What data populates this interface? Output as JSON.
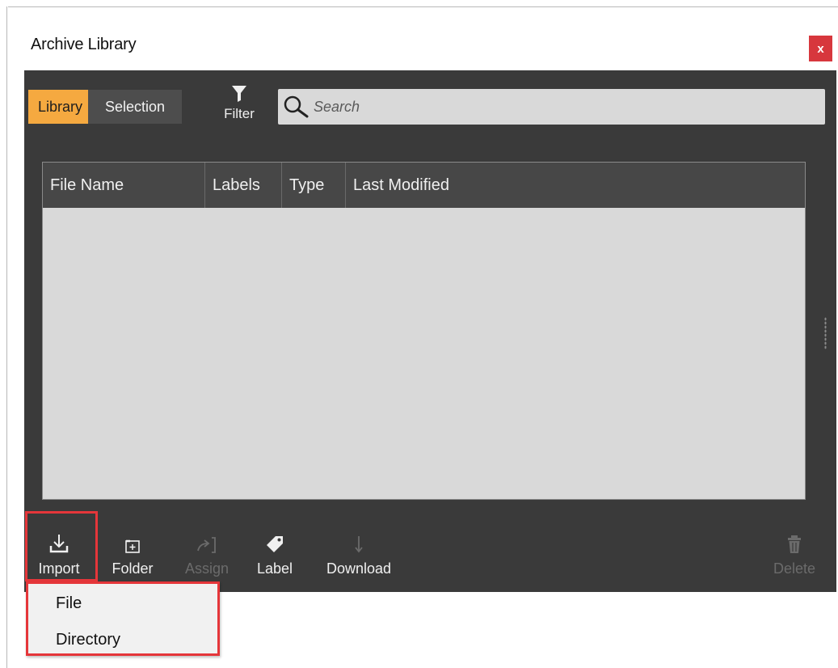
{
  "window": {
    "title": "Archive Library",
    "close_label": "x"
  },
  "tabs": [
    {
      "label": "Library",
      "active": true
    },
    {
      "label": "Selection",
      "active": false
    }
  ],
  "filter": {
    "label": "Filter",
    "icon": "funnel-icon"
  },
  "search": {
    "placeholder": "Search",
    "value": "",
    "icon": "search-icon"
  },
  "table": {
    "columns": [
      "File Name",
      "Labels",
      "Type",
      "Last Modified"
    ],
    "rows": []
  },
  "toolbar": {
    "import": {
      "label": "Import",
      "icon": "download-tray-icon",
      "enabled": true
    },
    "folder": {
      "label": "Folder",
      "icon": "folder-plus-icon",
      "enabled": true
    },
    "assign": {
      "label": "Assign",
      "icon": "assign-arrow-icon",
      "enabled": false
    },
    "label": {
      "label": "Label",
      "icon": "tag-icon",
      "enabled": true
    },
    "download": {
      "label": "Download",
      "icon": "arrow-down-icon",
      "enabled": true
    },
    "delete": {
      "label": "Delete",
      "icon": "trash-icon",
      "enabled": false
    }
  },
  "import_menu": {
    "items": [
      {
        "label": "File"
      },
      {
        "label": "Directory"
      }
    ]
  },
  "colors": {
    "accent": "#f5a940",
    "panel_bg": "#3a3a3a",
    "highlight": "#e5363a",
    "close_bg": "#d7373d"
  }
}
